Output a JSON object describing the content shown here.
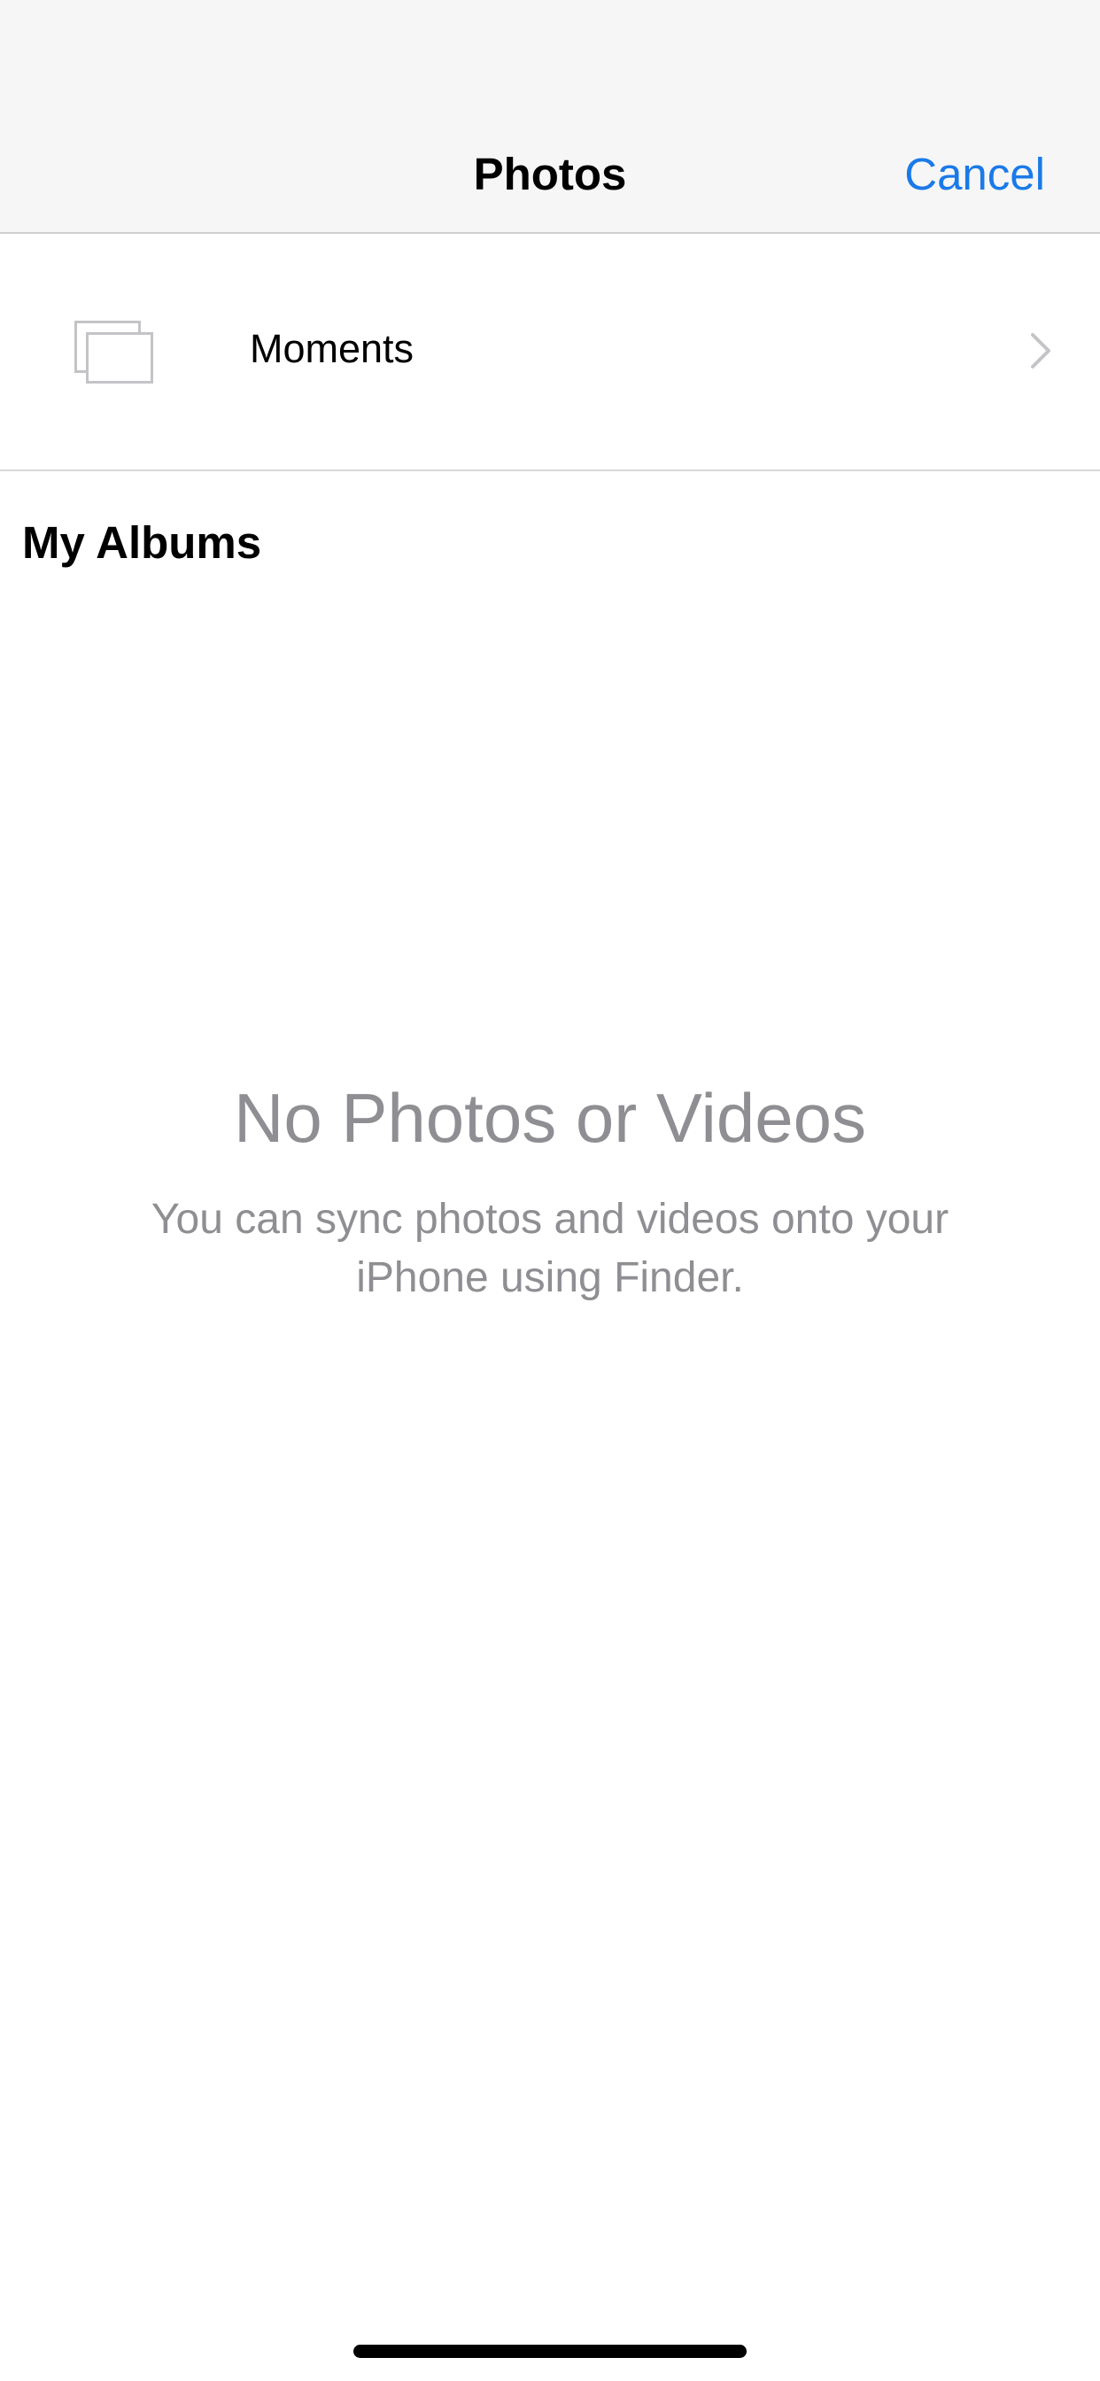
{
  "nav": {
    "title": "Photos",
    "cancel_label": "Cancel"
  },
  "moments": {
    "label": "Moments",
    "icon": "moments-stack-icon",
    "chevron_icon": "chevron-right-icon"
  },
  "albums": {
    "header": "My Albums"
  },
  "empty_state": {
    "title": "No Photos or Videos",
    "message": "You can sync photos and videos onto your iPhone using Finder."
  },
  "colors": {
    "accent": "#1a7ae8",
    "nav_background": "#f6f6f7",
    "secondary_text": "#8e8e93"
  }
}
